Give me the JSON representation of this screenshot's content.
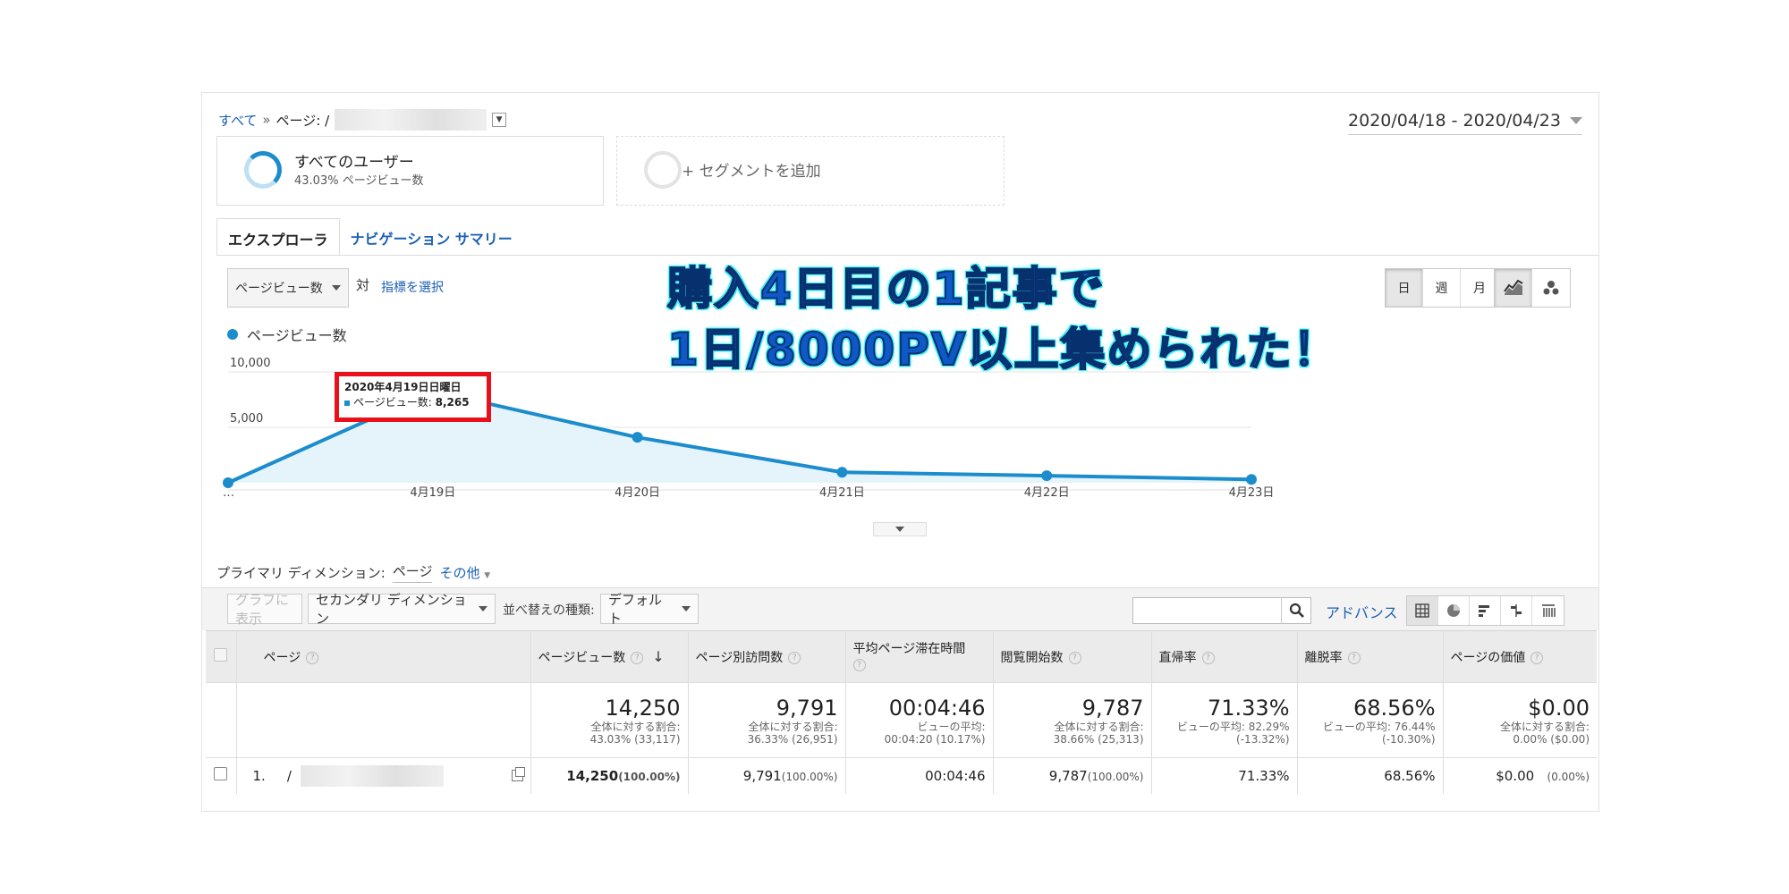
{
  "breadcrumb": {
    "all": "すべて",
    "sep": "»",
    "page_prefix": "ページ: /"
  },
  "date_range": "2020/04/18 - 2020/04/23",
  "segments": {
    "all_users_title": "すべてのユーザー",
    "all_users_sub": "43.03% ページビュー数",
    "add_segment": "+ セグメントを追加"
  },
  "tabs": [
    {
      "label": "エクスプローラ",
      "active": true
    },
    {
      "label": "ナビゲーション サマリー",
      "active": false
    }
  ],
  "metric": {
    "selected": "ページビュー数",
    "versus": "対",
    "pick_metric": "指標を選択"
  },
  "period_buttons": [
    "日",
    "週",
    "月"
  ],
  "legend_label": "ページビュー数",
  "annotation": {
    "line1": "購入4日目の1記事で",
    "line2": "1日/8000PV以上集められた！"
  },
  "tooltip": {
    "date": "2020年4月19日日曜日",
    "label": "ページビュー数:",
    "value": "8,265"
  },
  "chart_data": {
    "type": "area",
    "x": [
      "…",
      "4月19日",
      "4月20日",
      "4月21日",
      "4月22日",
      "4月23日"
    ],
    "y_ticks": [
      "5,000",
      "10,000"
    ],
    "ylim": [
      0,
      10000
    ],
    "series": [
      {
        "name": "ページビュー数",
        "values": [
          0,
          8265,
          4100,
          950,
          640,
          300
        ]
      }
    ],
    "color": "#1b8ccc"
  },
  "primary_dimension": {
    "label": "プライマリ ディメンション:",
    "current": "ページ",
    "other": "その他"
  },
  "toolbar": {
    "plot": "グラフに表示",
    "secondary": "セカンダリ ディメンション",
    "sort_label": "並べ替えの種類:",
    "sort_value": "デフォルト",
    "advanced": "アドバンス"
  },
  "table": {
    "headers": [
      "ページ",
      "ページビュー数",
      "ページ別訪問数",
      "平均ページ滞在時間",
      "閲覧開始数",
      "直帰率",
      "離脱率",
      "ページの価値"
    ],
    "totals": [
      {
        "main": "14,250",
        "l1": "全体に対する割合:",
        "l2": "43.03% (33,117)"
      },
      {
        "main": "9,791",
        "l1": "全体に対する割合:",
        "l2": "36.33% (26,951)"
      },
      {
        "main": "00:04:46",
        "l1": "ビューの平均:",
        "l2": "00:04:20 (10.17%)"
      },
      {
        "main": "9,787",
        "l1": "全体に対する割合:",
        "l2": "38.66% (25,313)"
      },
      {
        "main": "71.33%",
        "l1": "ビューの平均: 82.29%",
        "l2": "(-13.32%)"
      },
      {
        "main": "68.56%",
        "l1": "ビューの平均: 76.44%",
        "l2": "(-10.30%)"
      },
      {
        "main": "$0.00",
        "l1": "全体に対する割合:",
        "l2": "0.00% ($0.00)"
      }
    ],
    "row": {
      "index": "1.",
      "slash": "/",
      "pageviews": "14,250",
      "pageviews_pct": "(100.00%)",
      "unique": "9,791",
      "unique_pct": "(100.00%)",
      "avg_time": "00:04:46",
      "entrances": "9,787",
      "entrances_pct": "(100.00%)",
      "bounce": "71.33%",
      "exit": "68.56%",
      "value": "$0.00",
      "value_pct": "(0.00%)"
    }
  }
}
